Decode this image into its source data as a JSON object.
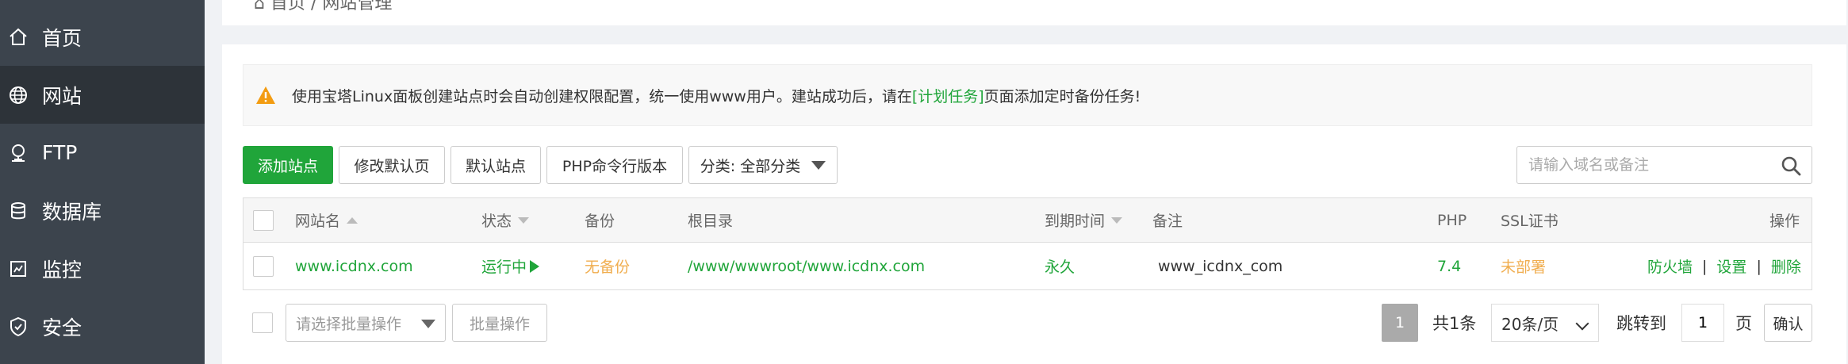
{
  "sidebar": {
    "items": [
      {
        "label": "首页",
        "icon": "home-icon"
      },
      {
        "label": "网站",
        "icon": "globe-icon",
        "active": true
      },
      {
        "label": "FTP",
        "icon": "ftp-icon"
      },
      {
        "label": "数据库",
        "icon": "database-icon"
      },
      {
        "label": "监控",
        "icon": "monitor-icon"
      },
      {
        "label": "安全",
        "icon": "shield-icon"
      }
    ]
  },
  "breadcrumb": {
    "text": "⌂ 首页 / 网站管理"
  },
  "alert": {
    "icon": "warning-icon",
    "text_before": "使用宝塔Linux面板创建站点时会自动创建权限配置，统一使用www用户。建站成功后，请在",
    "link": "[计划任务]",
    "text_after": "页面添加定时备份任务!"
  },
  "toolbar": {
    "add_site": "添加站点",
    "edit_default_page": "修改默认页",
    "default_site": "默认站点",
    "php_cli_version": "PHP命令行版本",
    "category": "分类: 全部分类"
  },
  "search": {
    "placeholder": "请输入域名或备注",
    "icon": "search-icon"
  },
  "table": {
    "headers": {
      "name": "网站名",
      "status": "状态",
      "backup": "备份",
      "root": "根目录",
      "expire": "到期时间",
      "remark": "备注",
      "php": "PHP",
      "ssl": "SSL证书",
      "actions": "操作"
    },
    "rows": [
      {
        "name": "www.icdnx.com",
        "status": "运行中",
        "backup": "无备份",
        "root": "/www/wwwroot/www.icdnx.com",
        "expire": "永久",
        "remark": "www_icdnx_com",
        "php": "7.4",
        "ssl": "未部署",
        "action_firewall": "防火墙",
        "action_settings": "设置",
        "action_delete": "删除",
        "separator": "|"
      }
    ]
  },
  "footer": {
    "batch_select_placeholder": "请选择批量操作",
    "batch_button": "批量操作",
    "current_page": "1",
    "total": "共1条",
    "per_page": "20条/页",
    "jump_label": "跳转到",
    "jump_value": "1",
    "page_unit": "页",
    "confirm": "确认"
  },
  "colors": {
    "sidebar_bg": "#3c444d",
    "sidebar_active": "#2d3339",
    "accent_green": "#20a53a",
    "orange": "#f0ad4e"
  }
}
